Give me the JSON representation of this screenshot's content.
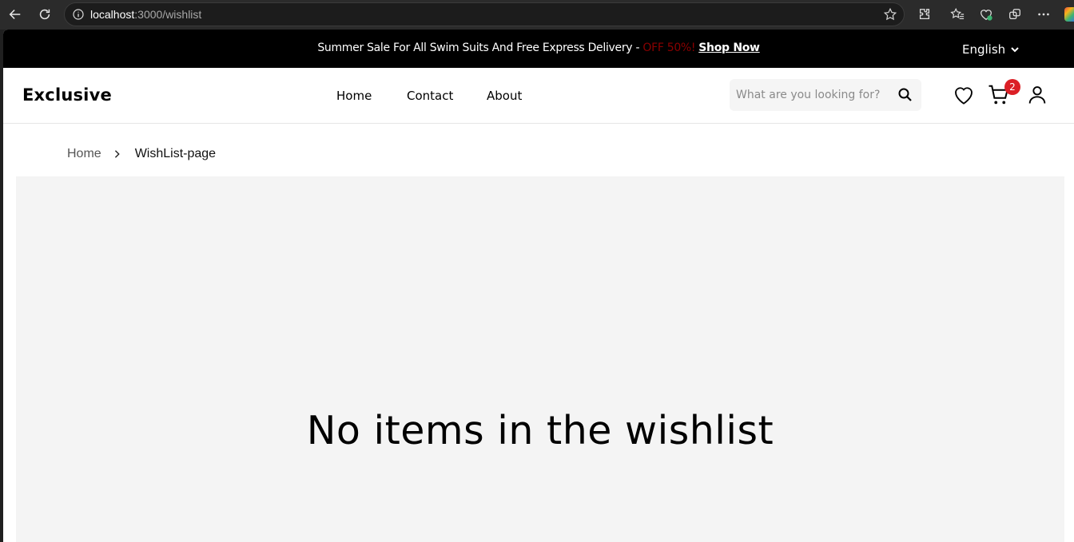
{
  "browser": {
    "url_host": "localhost",
    "url_rest": ":3000/wishlist"
  },
  "promo": {
    "text": "Summer Sale For All Swim Suits And Free Express Delivery - ",
    "off": "OFF 50%!",
    "shop_now": "Shop Now",
    "language": "English"
  },
  "header": {
    "logo": "Exclusive",
    "nav": {
      "home": "Home",
      "contact": "Contact",
      "about": "About"
    },
    "search_placeholder": "What are you looking for?",
    "cart_count": "2"
  },
  "breadcrumb": {
    "home": "Home",
    "current": "WishList-page"
  },
  "main": {
    "empty_message": "No items in the wishlist"
  },
  "colors": {
    "promo_bg": "#000000",
    "off_text": "#8b0000",
    "badge": "#db1f26",
    "content_bg": "#f4f4f4"
  }
}
